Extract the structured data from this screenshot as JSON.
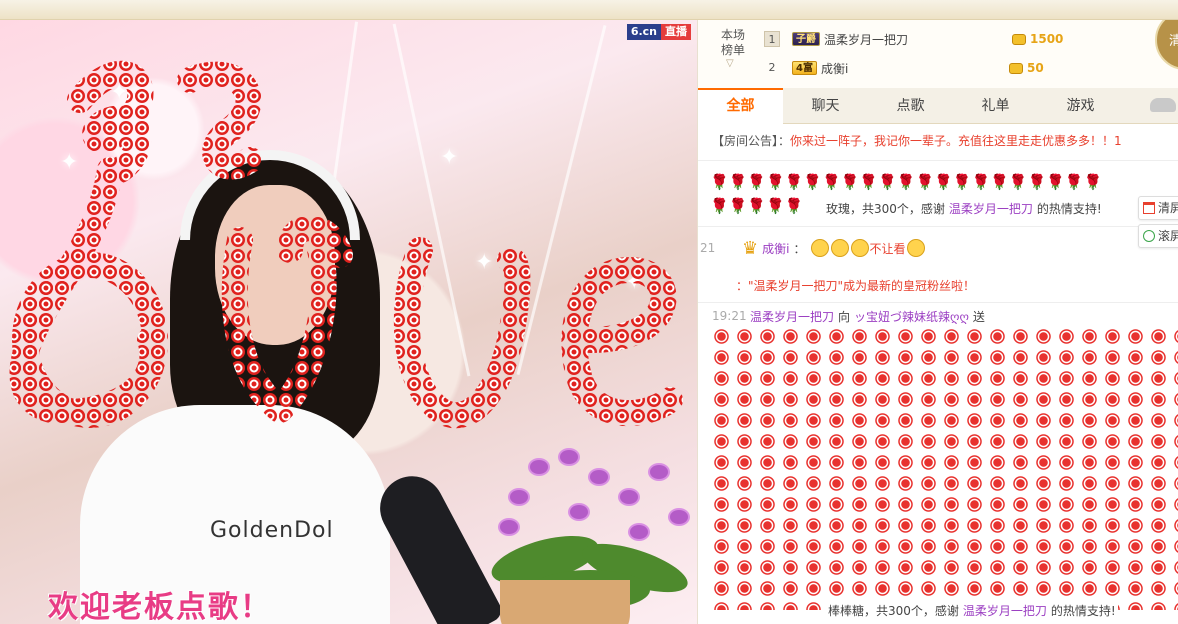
{
  "video": {
    "badge_site": "6.cn",
    "badge_live": "直播",
    "shirt_text": "GoldenDol",
    "welcome": "欢迎老板点歌！"
  },
  "rank": {
    "title": "本场榜单",
    "rows": [
      {
        "num": "1",
        "level": "子爵",
        "name": "温柔岁月一把刀",
        "coins": "1500"
      },
      {
        "num": "2",
        "level": "4富",
        "name": "成衡i",
        "coins": "50"
      }
    ],
    "avatar_label": "清"
  },
  "tabs": [
    "全部",
    "聊天",
    "点歌",
    "礼单",
    "游戏"
  ],
  "chat": {
    "notice_tag": "【房间公告】：",
    "notice_text": "你来过一阵子，我记你一辈子。充值往这里走走优惠多多！！1",
    "rose_gift": {
      "text_a": "玫瑰，共300个，感谢",
      "user": "温柔岁月一把刀",
      "text_b": "的热情支持!"
    },
    "msg1": {
      "time": "21",
      "user": "成衡i",
      "text": "不让看"
    },
    "msg2": {
      "prefix": "：",
      "text": "\"温柔岁月一把刀\"成为最新的皇冠粉丝啦！"
    },
    "msg3": {
      "time": "19:21",
      "from": "温柔岁月一把刀",
      "verb": "向",
      "to": "ッ宝妞づ辣妹纸辣ღღ",
      "action": "送"
    },
    "candy_gift": {
      "text_a": "棒棒糖，共300个，感谢",
      "user": "温柔岁月一把刀",
      "text_b": "的热情支持!"
    }
  },
  "side_buttons": {
    "clear": "清屏",
    "scroll": "滚屏"
  },
  "colors": {
    "accent": "#ff6a00",
    "gift_red": "#e8402e",
    "username": "#9b3ec2",
    "coin": "#e7a416"
  }
}
